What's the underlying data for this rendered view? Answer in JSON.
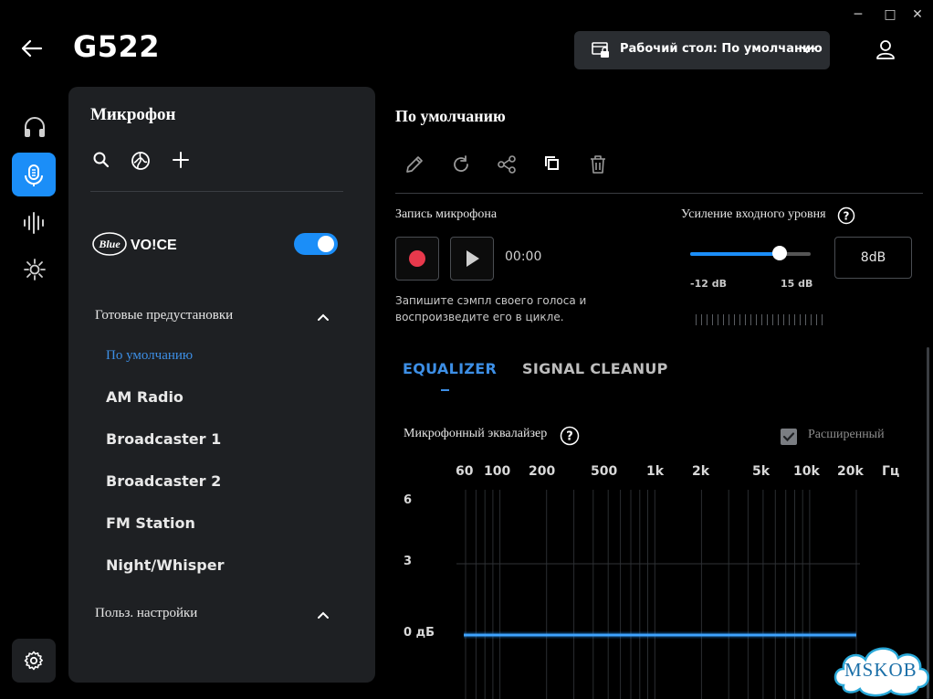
{
  "window": {
    "minimize": "─",
    "maximize": "□",
    "close": "✕"
  },
  "header": {
    "title": "G522",
    "back_icon": "arrow-left-icon",
    "profile": "Рабочий стол: По умолчанию"
  },
  "panel": {
    "title": "Микрофон",
    "brand": "VO!CE",
    "brand_logo": "Blue",
    "toggle_on": true,
    "presets_section": "Готовые предустановки",
    "presets": [
      "По умолчанию",
      "AM Radio",
      "Broadcaster 1",
      "Broadcaster 2",
      "FM Station",
      "Night/Whisper"
    ],
    "custom_section": "Польз. настройки"
  },
  "main": {
    "preset_title": "По умолчанию",
    "recording": {
      "label": "Запись микрофона",
      "time": "00:00",
      "hint": "Запишите сэмпл своего голоса и воспроизведите его в цикле."
    },
    "gain": {
      "label": "Усиление входного уровня",
      "min": "-12 dB",
      "max": "15 dB",
      "value": "8dB",
      "fraction": 0.74
    },
    "tabs": [
      "EQUALIZER",
      "SIGNAL CLEANUP"
    ],
    "active_tab": 0,
    "eq": {
      "label": "Микрофонный эквалайзер",
      "advanced_label": "Расширенный",
      "advanced_checked": true,
      "freqs": [
        "60",
        "100",
        "200",
        "500",
        "1k",
        "2k",
        "5k",
        "10k",
        "20k",
        "Гц"
      ],
      "y_labels": [
        "6",
        "3",
        "0 дБ"
      ]
    }
  },
  "watermark": "MSKOB",
  "colors": {
    "accent": "#1b8ef8",
    "record": "#e8394c",
    "panel": "#1e2023"
  }
}
